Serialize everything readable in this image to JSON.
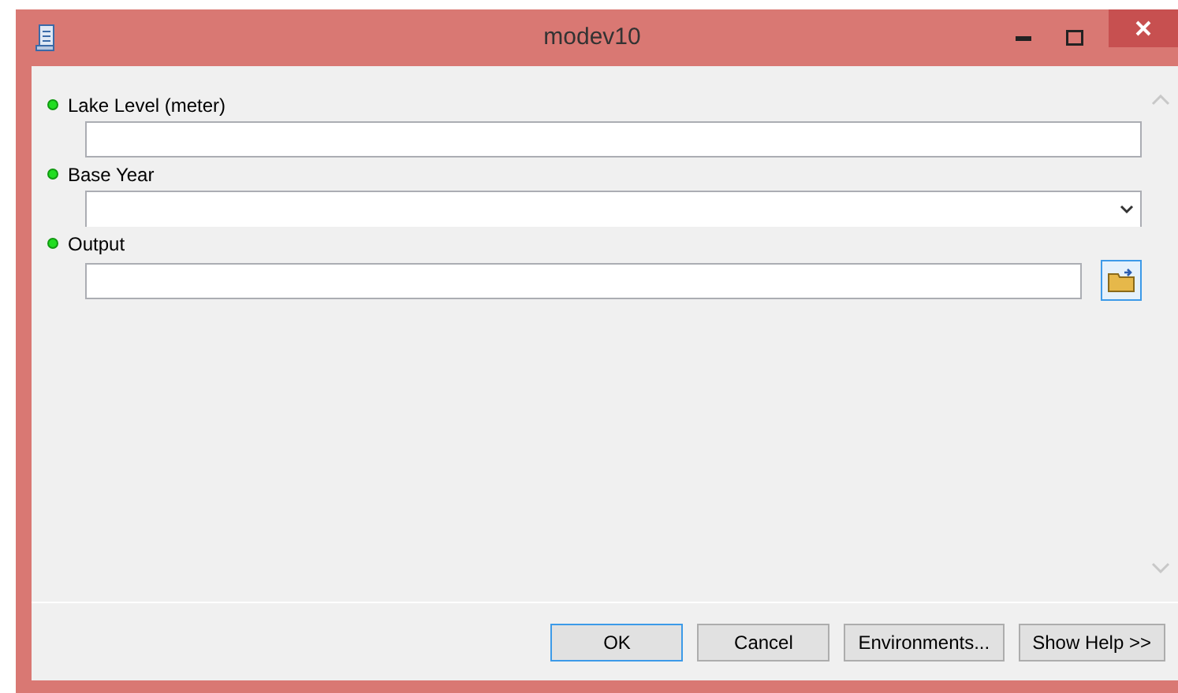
{
  "window": {
    "title": "modev10"
  },
  "parameters": [
    {
      "label": "Lake Level (meter)",
      "kind": "text"
    },
    {
      "label": "Base Year",
      "kind": "dropdown"
    },
    {
      "label": "Output",
      "kind": "file"
    }
  ],
  "buttons": [
    {
      "label": "OK",
      "selected": true
    },
    {
      "label": "Cancel",
      "selected": false
    },
    {
      "label": "Environments...",
      "selected": false
    },
    {
      "label": "Show Help >>",
      "selected": false
    }
  ]
}
